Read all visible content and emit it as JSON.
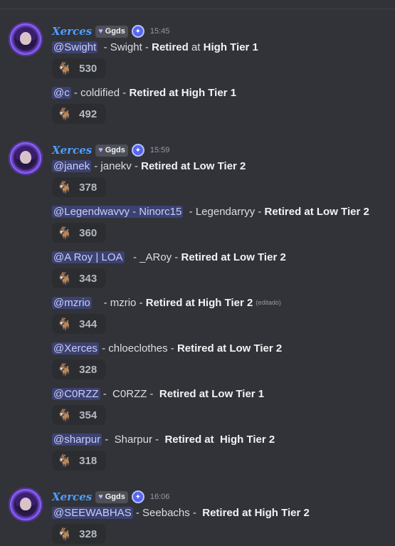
{
  "author": {
    "name": "Xerces",
    "tag": "Ggds",
    "tag_icon": "purple-heart-icon",
    "badge_icon": "discord-badge-icon"
  },
  "reaction_emoji": "🐐",
  "groups": [
    {
      "time": "15:45",
      "entries": [
        {
          "mention": "@Swight",
          "text": "  - Swight - ",
          "bold": "Retired",
          "text2": " at ",
          "bold2": "High Tier 1",
          "count": "530"
        },
        {
          "mention": "@c",
          "text": " - coldified - ",
          "bold": "Retired at High Tier 1",
          "count": "492"
        }
      ]
    },
    {
      "time": "15:59",
      "entries": [
        {
          "mention": "@janek",
          "text": " - janekv - ",
          "bold": "Retired at Low Tier 2",
          "count": "378"
        },
        {
          "mention": "@Legendwavvy - Ninorc15",
          "text": "  - Legendarryy - ",
          "bold": "Retired at Low Tier 2",
          "count": "360"
        },
        {
          "mention": "@A Roy | LOA",
          "text": "   - _ARoy - ",
          "bold": "Retired at Low Tier 2",
          "count": "343"
        },
        {
          "mention": "@mzrio",
          "text": "    - mzrio - ",
          "bold": "Retired at High Tier 2",
          "edited": "(editado)",
          "count": "344"
        },
        {
          "mention": "@Xerces",
          "text": " - chloeclothes - ",
          "bold": "Retired at Low Tier 2",
          "count": "328"
        },
        {
          "mention": "@C0RZZ",
          "text": " -  C0RZZ -  ",
          "bold": "Retired at Low Tier 1",
          "count": "354"
        },
        {
          "mention": "@sharpur",
          "text": " -  Sharpur -  ",
          "bold": "Retired at  High Tier 2",
          "count": "318"
        }
      ]
    },
    {
      "time": "16:06",
      "entries": [
        {
          "mention": "@SEEWABHAS",
          "text": " - Seebachs -  ",
          "bold": "Retired at High Tier 2",
          "count": "328"
        }
      ]
    }
  ]
}
